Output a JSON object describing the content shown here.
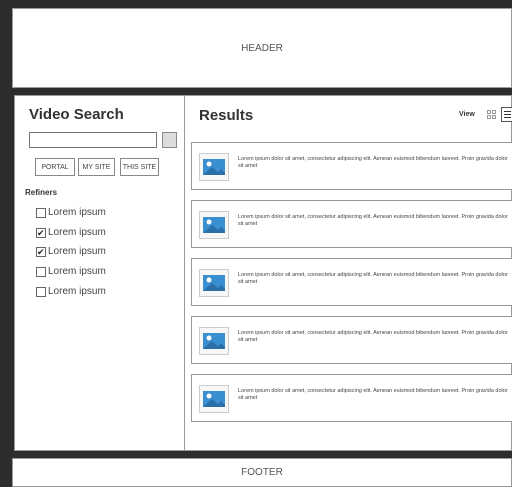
{
  "header": {
    "label": "HEADER"
  },
  "footer": {
    "label": "FOOTER"
  },
  "sidebar": {
    "title": "Video Search",
    "search_placeholder": "",
    "scopes": [
      "PORTAL",
      "MY SITE",
      "THIS SITE"
    ],
    "refiners_title": "Refiners",
    "refiners": [
      {
        "label": "Lorem ipsum",
        "checked": false
      },
      {
        "label": "Lorem ipsum",
        "checked": true
      },
      {
        "label": "Lorem ipsum",
        "checked": true
      },
      {
        "label": "Lorem ipsum",
        "checked": false
      },
      {
        "label": "Lorem ipsum",
        "checked": false
      }
    ]
  },
  "results": {
    "title": "Results",
    "view_label": "View",
    "items": [
      {
        "text": "Lorem ipsum dolor sit amet, consectetur adipiscing elit. Aenean euismod bibendum laoreet. Proin gravida dolor sit amet"
      },
      {
        "text": "Lorem ipsum dolor sit amet, consectetur adipiscing elit. Aenean euismod bibendum laoreet. Proin gravida dolor sit amet"
      },
      {
        "text": "Lorem ipsum dolor sit amet, consectetur adipiscing elit. Aenean euismod bibendum laoreet. Proin gravida dolor sit amet"
      },
      {
        "text": "Lorem ipsum dolor sit amet, consectetur adipiscing elit. Aenean euismod bibendum laoreet. Proin gravida dolor sit amet"
      },
      {
        "text": "Lorem ipsum dolor sit amet, consectetur adipiscing elit. Aenean euismod bibendum laoreet. Proin gravida dolor sit amet"
      }
    ]
  },
  "colors": {
    "thumb_sky": "#3a8fd0",
    "thumb_ground": "#2a6fa8",
    "background": "#2d2d2d"
  }
}
